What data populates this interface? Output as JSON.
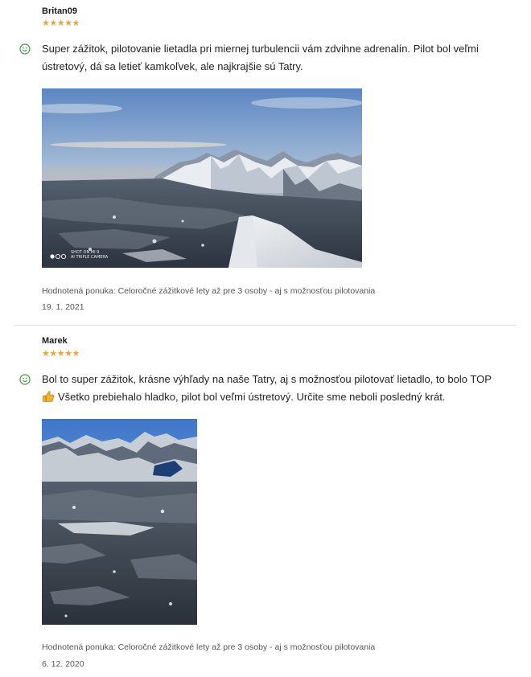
{
  "reviews": [
    {
      "reviewer": "Britan09",
      "stars": "★★★★★",
      "rating": 5,
      "text": "Super zážitok, pilotovanie lietadla pri miernej turbulencii vám zdvihne adrenalín. Pilot bol veľmi ústretový, dá sa letieť kamkoľvek, ale najkrajšie sú Tatry.",
      "photo_watermark_line1": "SHOT ON MI 9",
      "photo_watermark_line2": "AI TRIPLE CAMERA",
      "offer": "Hodnotená ponuka: Celoročné zážitkové lety až pre 3 osoby - aj s možnosťou pilotovania",
      "date": "19. 1. 2021"
    },
    {
      "reviewer": "Marek",
      "stars": "★★★★★",
      "rating": 5,
      "text_line1": "Bol to super zážitok, krásne výhľady na naše Tatry, aj s možnosťou pilotovať lietadlo, to bolo TOP",
      "text_line2": "Všetko prebiehalo hladko, pilot bol veľmi ústretový. Určite sme neboli posledný krát.",
      "offer": "Hodnotená ponuka: Celoročné zážitkové lety až pre 3 osoby - aj s možnosťou pilotovania",
      "date": "6. 12. 2020"
    }
  ],
  "colors": {
    "star": "#f2a23a",
    "smile": "#3a9a3a",
    "thumb": "#f1b52a",
    "divider": "#e2e2e2"
  },
  "icons": {
    "sentiment": "smile-icon",
    "emoji": "thumbs-up-icon"
  }
}
